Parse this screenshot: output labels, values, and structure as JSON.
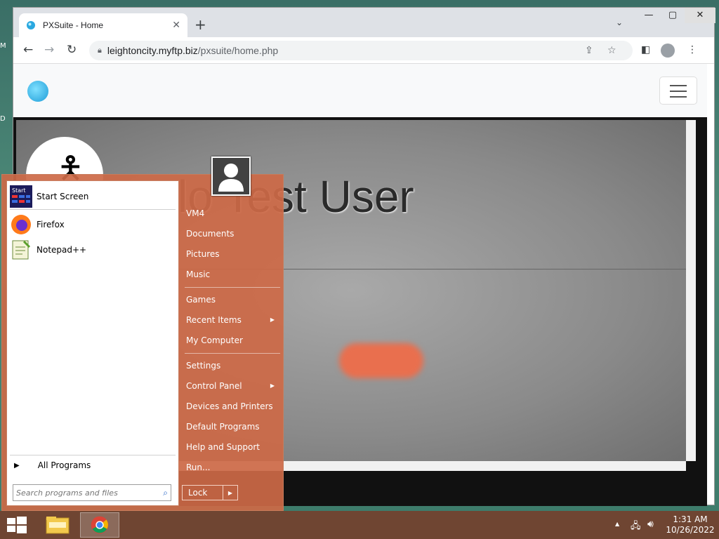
{
  "desktop": {
    "label_top": "M",
    "label_mid": "D"
  },
  "browser": {
    "tab_title": "PXSuite - Home",
    "tab_close": "✕",
    "new_tab": "+",
    "tab_search": "⌄",
    "win_min": "—",
    "win_max": "▢",
    "win_close": "✕",
    "url_host": "leightoncity.myftp.biz",
    "url_path": "/pxsuite/home.php"
  },
  "page": {
    "hero_title": "lo Test User"
  },
  "start_menu": {
    "pinned": [
      {
        "label": "Start Screen"
      },
      {
        "label": "Firefox"
      },
      {
        "label": "Notepad++"
      }
    ],
    "all_programs": "All Programs",
    "search_placeholder": "Search programs and files",
    "right_items": [
      {
        "label": "VM4"
      },
      {
        "label": "Documents"
      },
      {
        "label": "Pictures"
      },
      {
        "label": "Music"
      },
      {
        "label": "Games"
      },
      {
        "label": "Recent Items"
      },
      {
        "label": "My Computer"
      },
      {
        "label": "Settings"
      },
      {
        "label": "Control Panel"
      },
      {
        "label": "Devices and Printers"
      },
      {
        "label": "Default Programs"
      },
      {
        "label": "Help and Support"
      },
      {
        "label": "Run..."
      }
    ],
    "lock_label": "Lock"
  },
  "taskbar": {
    "time": "1:31 AM",
    "date": "10/26/2022"
  },
  "colors": {
    "start_menu": "#cd6946",
    "taskbar": "#783c28",
    "hero_button": "#e96f4e"
  }
}
